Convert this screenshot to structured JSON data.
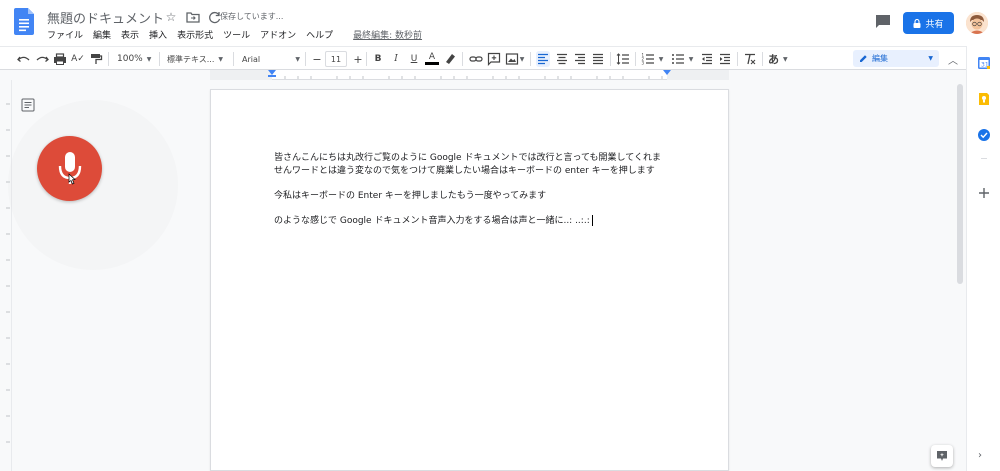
{
  "header": {
    "doc_title": "無題のドキュメント",
    "save_status": "保存しています...",
    "menu": [
      "ファイル",
      "編集",
      "表示",
      "挿入",
      "表示形式",
      "ツール",
      "アドオン",
      "ヘルプ"
    ],
    "last_edit": "最終編集: 数秒前",
    "share_label": "共有"
  },
  "toolbar": {
    "zoom": "100%",
    "style": "標準テキス...",
    "font": "Arial",
    "font_size": "11",
    "mode": "編集",
    "input_tool": "あ"
  },
  "document": {
    "paragraphs": [
      "皆さんこんにちは丸改行ご覧のように Google ドキュメントでは改行と言っても開業してくれませんワードとは違う変なので気をつけて廃業したい場合はキーボードの enter キーを押します",
      "今私はキーボードの Enter キーを押しましたもう一度やってみます",
      "のような感じで Google ドキュメント音声入力をする場合は声と一緒に..: ..:.:"
    ]
  },
  "colors": {
    "accent": "#1a73e8",
    "mic": "#dd4b39",
    "doc_blue": "#4285f4"
  }
}
